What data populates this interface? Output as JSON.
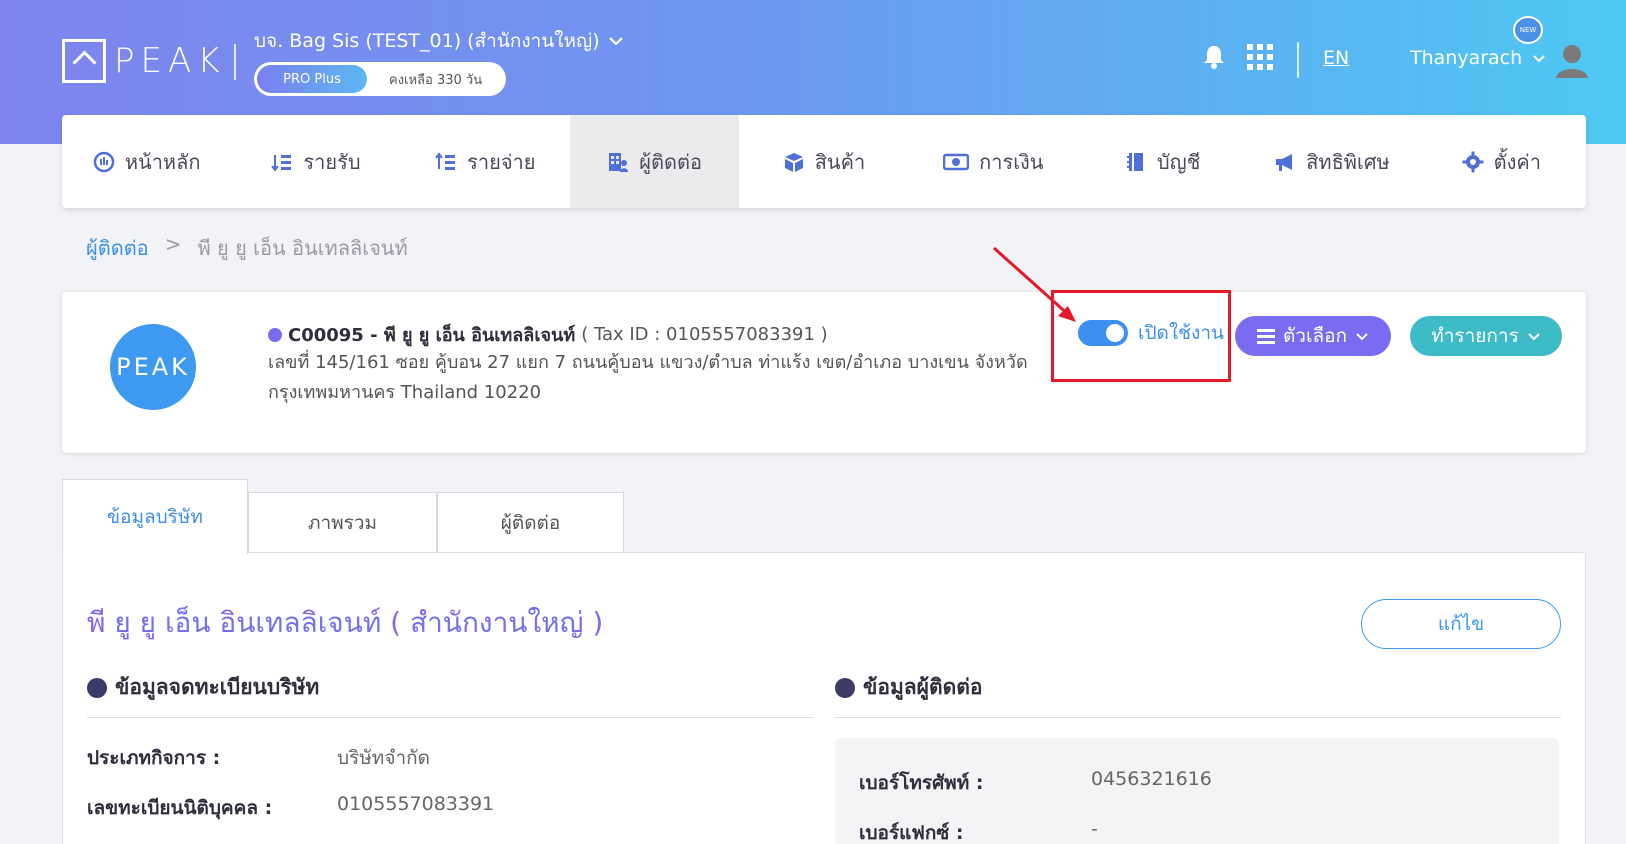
{
  "header": {
    "logo_text": "PEAK",
    "company": "บจ. Bag Sis (TEST_01) (สำนักงานใหญ่)",
    "plan_badge": "PRO Plus",
    "plan_remaining": "คงเหลือ 330 วัน",
    "language": "EN",
    "user_name": "Thanyarach",
    "new_badge": "NEW"
  },
  "nav": {
    "items": [
      {
        "label": "หน้าหลัก",
        "icon": "gauge-icon"
      },
      {
        "label": "รายรับ",
        "icon": "income-list-icon"
      },
      {
        "label": "รายจ่าย",
        "icon": "expense-list-icon"
      },
      {
        "label": "ผู้ติดต่อ",
        "icon": "contacts-building-icon"
      },
      {
        "label": "สินค้า",
        "icon": "box-icon"
      },
      {
        "label": "การเงิน",
        "icon": "money-icon"
      },
      {
        "label": "บัญชี",
        "icon": "book-icon"
      },
      {
        "label": "สิทธิพิเศษ",
        "icon": "megaphone-icon"
      },
      {
        "label": "ตั้งค่า",
        "icon": "gear-icon"
      }
    ],
    "active_index": 3
  },
  "breadcrumb": {
    "parent": "ผู้ติดต่อ",
    "separator": ">",
    "current": "พี ยู ยู เอ็น อินเทลลิเจนท์"
  },
  "contact": {
    "avatar_text": "PEAK",
    "code_name": "C00095 - พี ยู ยู เอ็น อินเทลลิเจนท์",
    "tax_id": "( Tax ID : 0105557083391 )",
    "address": "เลขที่ 145/161 ซอย คู้บอน 27 แยก 7 ถนนคู้บอน แขวง/ตำบล ท่าแร้ง เขต/อำเภอ บางเขน จังหวัด กรุงเทพมหานคร Thailand 10220",
    "toggle_label": "เปิดใช้งาน",
    "toggle_on": true,
    "options_button": "ตัวเลือก",
    "action_button": "ทำรายการ"
  },
  "tabs": [
    {
      "label": "ข้อมูลบริษัท",
      "active": true
    },
    {
      "label": "ภาพรวม",
      "active": false
    },
    {
      "label": "ผู้ติดต่อ",
      "active": false
    }
  ],
  "detail": {
    "title": "พี ยู ยู เอ็น อินเทลลิเจนท์ ( สำนักงานใหญ่ )",
    "edit_button": "แก้ไข",
    "registration_section": "ข้อมูลจดทะเบียนบริษัท",
    "contact_section": "ข้อมูลผู้ติดต่อ",
    "registration_fields": [
      {
        "label": "ประเภทกิจการ :",
        "value": "บริษัทจำกัด"
      },
      {
        "label": "เลขทะเบียนนิติบุคคล :",
        "value": "0105557083391"
      }
    ],
    "contact_fields": [
      {
        "label": "เบอร์โทรศัพท์ :",
        "value": "0456321616"
      },
      {
        "label": "เบอร์แฟกซ์ :",
        "value": "-"
      }
    ]
  },
  "colors": {
    "accent_purple": "#7a6cf0",
    "accent_blue": "#3d8ff0",
    "accent_teal": "#3dbcc8",
    "highlight_red": "#e6192a"
  }
}
